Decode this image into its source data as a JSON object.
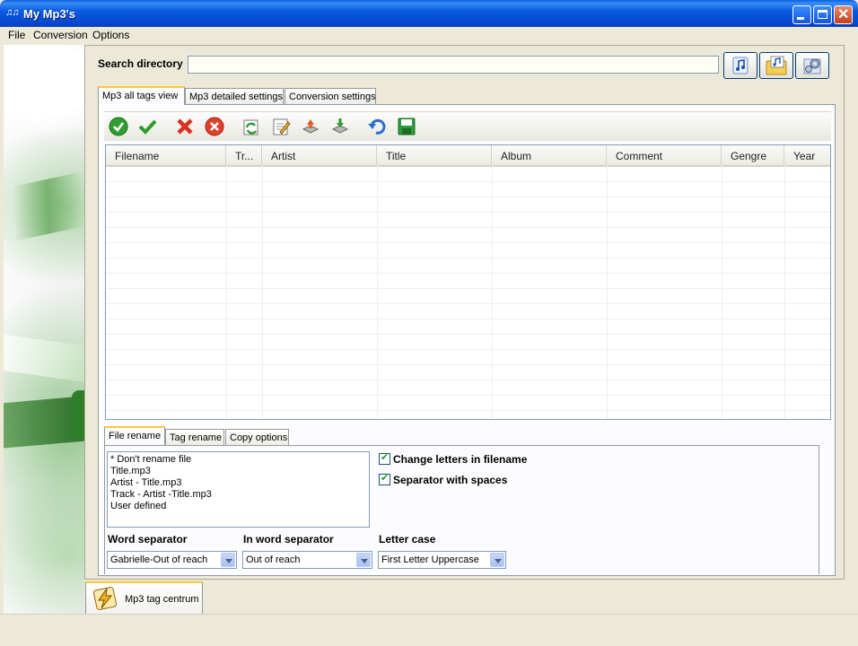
{
  "window": {
    "title": "My Mp3's",
    "app_icon": "mp3-app-icon"
  },
  "menu": [
    "File",
    "Conversion",
    "Options"
  ],
  "search": {
    "label": "Search directory",
    "value": ""
  },
  "top_buttons": [
    "music-note-icon",
    "music-folder-icon",
    "settings-gear-icon"
  ],
  "main_tabs": [
    "Mp3 all tags view",
    "Mp3 detailed settings",
    "Conversion settings"
  ],
  "toolbar_icons": [
    "check-circle-icon",
    "check-icon",
    "x-icon",
    "x-circle-icon",
    "refresh-icon",
    "edit-icon",
    "export-icon",
    "import-icon",
    "undo-icon",
    "save-icon"
  ],
  "grid": {
    "columns": [
      "Filename",
      "Tr...",
      "Artist",
      "Title",
      "Album",
      "Comment",
      "Gengre",
      "Year"
    ],
    "row_count": 16
  },
  "lower_tabs": [
    "File rename",
    "Tag rename",
    "Copy options"
  ],
  "rename_options": [
    "* Don't rename file",
    "Title.mp3",
    "Artist - Title.mp3",
    "Track - Artist -Title.mp3",
    "User defined"
  ],
  "checkboxes": [
    {
      "label": "Change letters in filename",
      "checked": true
    },
    {
      "label": "Separator with spaces",
      "checked": true
    }
  ],
  "dropdowns": [
    {
      "label": "Word separator",
      "value": "Gabrielle-Out of reach"
    },
    {
      "label": "In word separator",
      "value": "Out of reach"
    },
    {
      "label": "Letter case",
      "value": "First Letter Uppercase"
    }
  ],
  "bottom_tab": {
    "label": "Mp3 tag centrum",
    "icon": "lightning-icon"
  },
  "colors": {
    "title_bar": "#0b5be0",
    "tab_highlight": "#ffc83c",
    "background": "#ece9d8",
    "leaf_green": "#3c8a2a"
  }
}
